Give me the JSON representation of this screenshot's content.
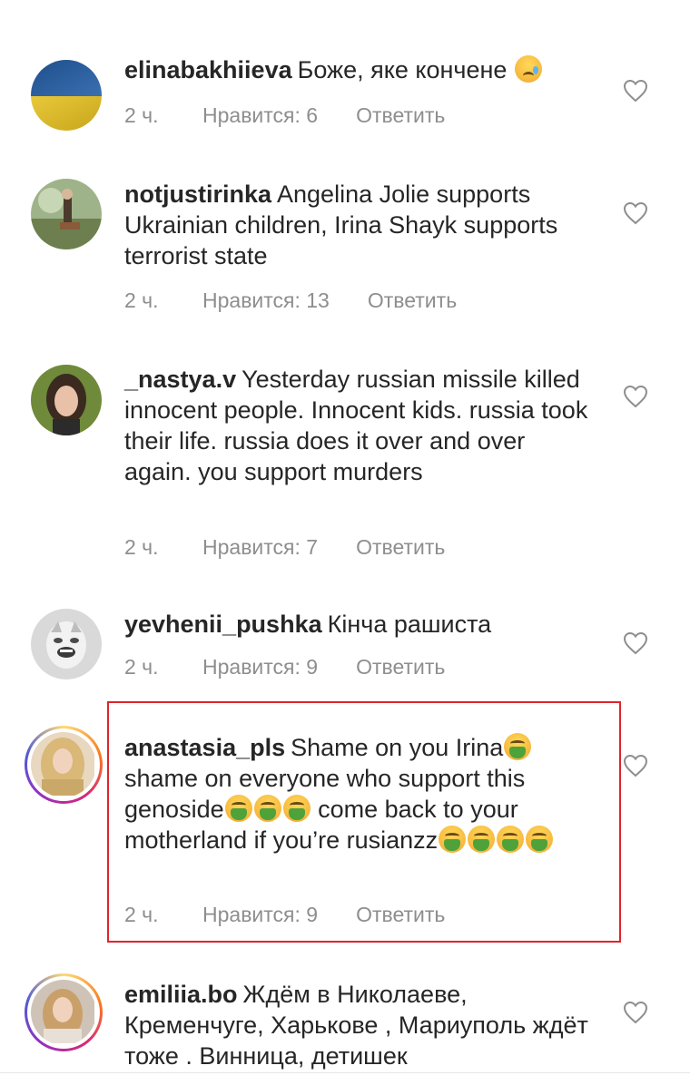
{
  "comments": [
    {
      "username": "elinabakhiieva",
      "text": "Боже, яке кончене",
      "time": "2 ч.",
      "likes": "Нравится: 6",
      "reply": "Ответить",
      "avatar": "ukraine-flag-avatar"
    },
    {
      "username": "notjustirinka",
      "text": "Angelina Jolie supports Ukrainian children, Irina Shayk supports terrorist state",
      "time": "2 ч.",
      "likes": "Нравится: 13",
      "reply": "Ответить",
      "avatar": "outdoor-photo-avatar"
    },
    {
      "username": "_nastya.v",
      "text": "Yesterday russian missile killed innocent people. Innocent kids. russia took their life. russia does it over and over again. you support murders",
      "time": "2 ч.",
      "likes": "Нравится: 7",
      "reply": "Ответить",
      "avatar": "portrait-avatar"
    },
    {
      "username": "yevhenii_pushka",
      "text": "Кінча рашиста",
      "time": "2 ч.",
      "likes": "Нравится: 9",
      "reply": "Ответить",
      "avatar": "masked-face-avatar"
    },
    {
      "username": "anastasia_pls",
      "text_1": "Shame on you Irina",
      "text_2": "shame on everyone who support this genoside",
      "text_3": "come back to your motherland if you’re rusianzz",
      "time": "2 ч.",
      "likes": "Нравится: 9",
      "reply": "Ответить",
      "avatar": "blonde-portrait-avatar",
      "highlighted": true
    },
    {
      "username": "emiliia.bo",
      "text": "Ждём в Николаеве, Кременчуге, Харькове , Мариуполь ждёт тоже . Винница, детишек",
      "avatar": "blonde-portrait-avatar"
    }
  ],
  "colors": {
    "text": "#262626",
    "meta": "#8e8e8e",
    "highlight_border": "#e0242b"
  }
}
